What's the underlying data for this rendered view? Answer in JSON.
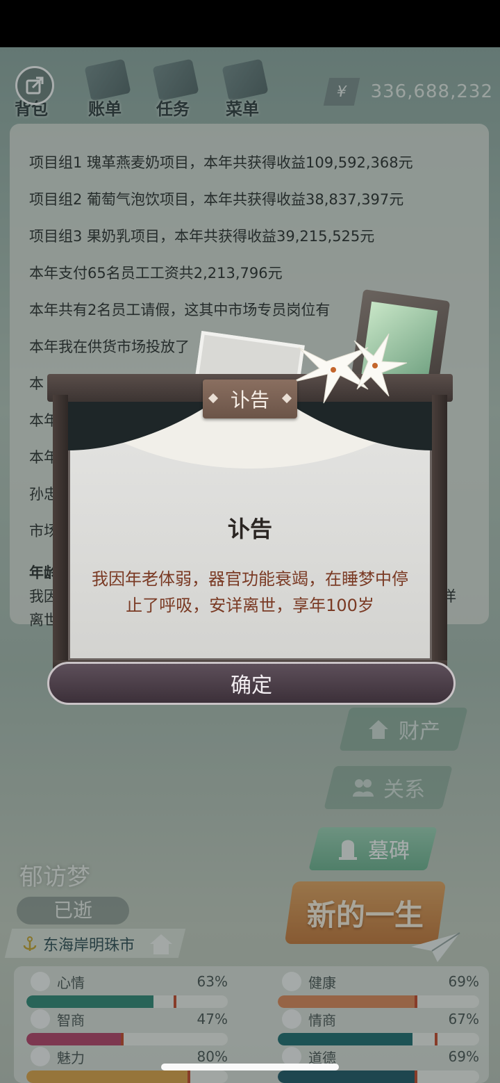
{
  "nav": {
    "items": [
      {
        "label": "背包",
        "icon": "backpack-icon"
      },
      {
        "label": "账单",
        "icon": "bill-icon"
      },
      {
        "label": "任务",
        "icon": "task-icon"
      },
      {
        "label": "菜单",
        "icon": "menu-icon"
      }
    ],
    "currency_symbol": "¥",
    "money": "336,688,232"
  },
  "report": {
    "lines": [
      "项目组1 瑰革燕麦奶项目，本年共获得收益109,592,368元",
      "项目组2 葡萄气泡饮项目，本年共获得收益38,837,397元",
      "项目组3 果奶乳项目，本年共获得收益39,215,525元",
      "本年支付65名员工工资共2,213,796元",
      "本年共有2名员工请假，这其中市场专员岗位有",
      "本年我在供货市场投放了",
      "本",
      "本年",
      "本年",
      "孙忠",
      "市场"
    ],
    "heading": "年龄",
    "tail1_left": "我因",
    "tail1_right": "洋",
    "tail2": "离世"
  },
  "dialog": {
    "plate_title": "讣告",
    "heading": "讣告",
    "body": "我因年老体弱，器官功能衰竭，在睡梦中停止了呼吸，安详离世，享年100岁",
    "confirm": "确定"
  },
  "side": {
    "property": "财产",
    "relations": "关系",
    "tombstone": "墓碑",
    "new_life": "新的一生"
  },
  "character": {
    "name": "郁访梦",
    "status": "已逝",
    "city": "东海岸明珠市"
  },
  "stats": [
    {
      "label": "心情",
      "value": "63%",
      "pct": 63,
      "color": "#2f8a76",
      "marker": 73,
      "icon": "smile-icon"
    },
    {
      "label": "健康",
      "value": "69%",
      "pct": 69,
      "color": "#e08a5a",
      "marker": 68,
      "icon": "heart-icon"
    },
    {
      "label": "智商",
      "value": "47%",
      "pct": 47,
      "color": "#b8426a",
      "marker": 47,
      "icon": "bulb-icon"
    },
    {
      "label": "情商",
      "value": "67%",
      "pct": 67,
      "color": "#1e6f72",
      "marker": 78,
      "icon": "apple-icon"
    },
    {
      "label": "魅力",
      "value": "80%",
      "pct": 80,
      "color": "#e1a548",
      "marker": 80,
      "icon": "sparkle-icon"
    },
    {
      "label": "道德",
      "value": "69%",
      "pct": 69,
      "color": "#1f5968",
      "marker": 68,
      "icon": "scale-icon"
    }
  ]
}
